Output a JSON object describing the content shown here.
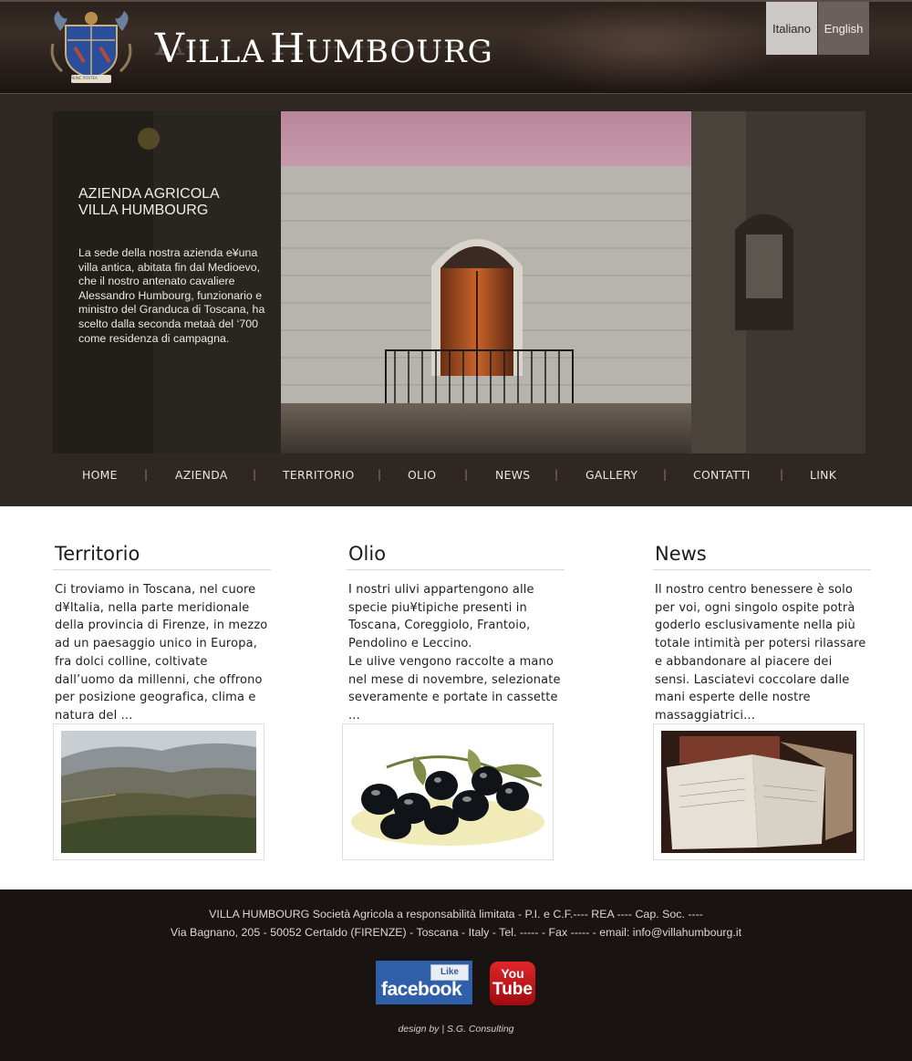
{
  "header": {
    "logo_cap_v": "V",
    "logo_rest_1": "ILLA",
    "logo_cap_h": "H",
    "logo_rest_2": "UMBOURG",
    "crest_motto": "NUNC POSTEA",
    "languages": [
      "Italiano",
      "English"
    ]
  },
  "hero": {
    "title": "AZIENDA AGRICOLA\nVILLA HUMBOURG",
    "text": "La sede della nostra azienda e¥una villa antica, abitata fin dal Medioevo, che il nostro antenato cavaliere Alessandro Humbourg, funzionario e ministro del Granduca di Toscana, ha scelto dalla  seconda metaà del ‘700 come residenza di campagna."
  },
  "nav": {
    "items": [
      "HOME",
      "AZIENDA",
      "TERRITORIO",
      "OLIO",
      "NEWS",
      "GALLERY",
      "CONTATTI",
      "LINK"
    ],
    "separator": "|"
  },
  "columns": [
    {
      "title": "Territorio",
      "text": "Ci troviamo in Toscana, nel cuore d¥Italia, nella parte meridionale della provincia di Firenze, in mezzo ad un paesaggio unico in Europa, fra dolci colline, coltivate dall’uomo da millenni, che offrono per posizione geografica, clima e natura del ..."
    },
    {
      "title": "Olio",
      "text": "I nostri ulivi appartengono alle specie piu¥tipiche presenti in Toscana, Coreggiolo, Frantoio, Pendolino e Leccino.\nLe ulive vengono raccolte a mano nel mese di novembre, selezionate severamente e portate in cassette ..."
    },
    {
      "title": "News",
      "text": "Il nostro centro benessere è solo per voi,  ogni singolo ospite potrà goderlo esclusivamente nella più totale intimità per potersi rilassare e abbandonare al piacere dei sensi. Lasciatevi coccolare dalle mani esperte delle nostre massaggiatrici..."
    }
  ],
  "footer": {
    "line1": "VILLA HUMBOURG Società Agricola a responsabilità limitata - P.I. e C.F.---- REA ---- Cap. Soc. ----",
    "line2": "Via Bagnano, 205 - 50052 Certaldo (FIRENZE) - Toscana - Italy - Tel. ----- - Fax ----- - email: info@villahumbourg.it",
    "facebook_like": "Like",
    "facebook_text": "facebook",
    "youtube_you": "You",
    "youtube_tube": "Tube",
    "credit": "design by | S.G. Consulting"
  }
}
